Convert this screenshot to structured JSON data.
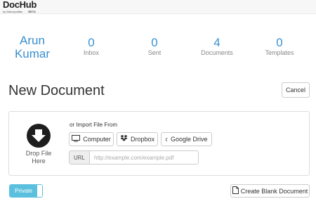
{
  "brand": {
    "name": "DocHub",
    "tagline": "by Macropolitan",
    "badge": "BETA"
  },
  "user": {
    "first_name": "Arun",
    "last_name": "Kumar"
  },
  "stats": [
    {
      "count": "0",
      "label": "Inbox"
    },
    {
      "count": "0",
      "label": "Sent"
    },
    {
      "count": "4",
      "label": "Documents"
    },
    {
      "count": "0",
      "label": "Templates"
    }
  ],
  "page": {
    "title": "New Document",
    "cancel_label": "Cancel"
  },
  "drop": {
    "label_line1": "Drop File",
    "label_line2": "Here",
    "icon": "download-arrow-icon"
  },
  "import": {
    "label": "or Import File From",
    "sources": [
      {
        "label": "Computer",
        "icon": "monitor-icon"
      },
      {
        "label": "Dropbox",
        "icon": "dropbox-icon"
      },
      {
        "label": "Google Drive",
        "icon": "google-icon"
      }
    ],
    "url_addon": "URL",
    "url_placeholder": "http://example.com/example.pdf"
  },
  "footer": {
    "privacy_label": "Private",
    "create_blank_label": "Create Blank Document"
  },
  "colors": {
    "accent": "#3a8fd0",
    "toggle": "#5bc0de"
  }
}
